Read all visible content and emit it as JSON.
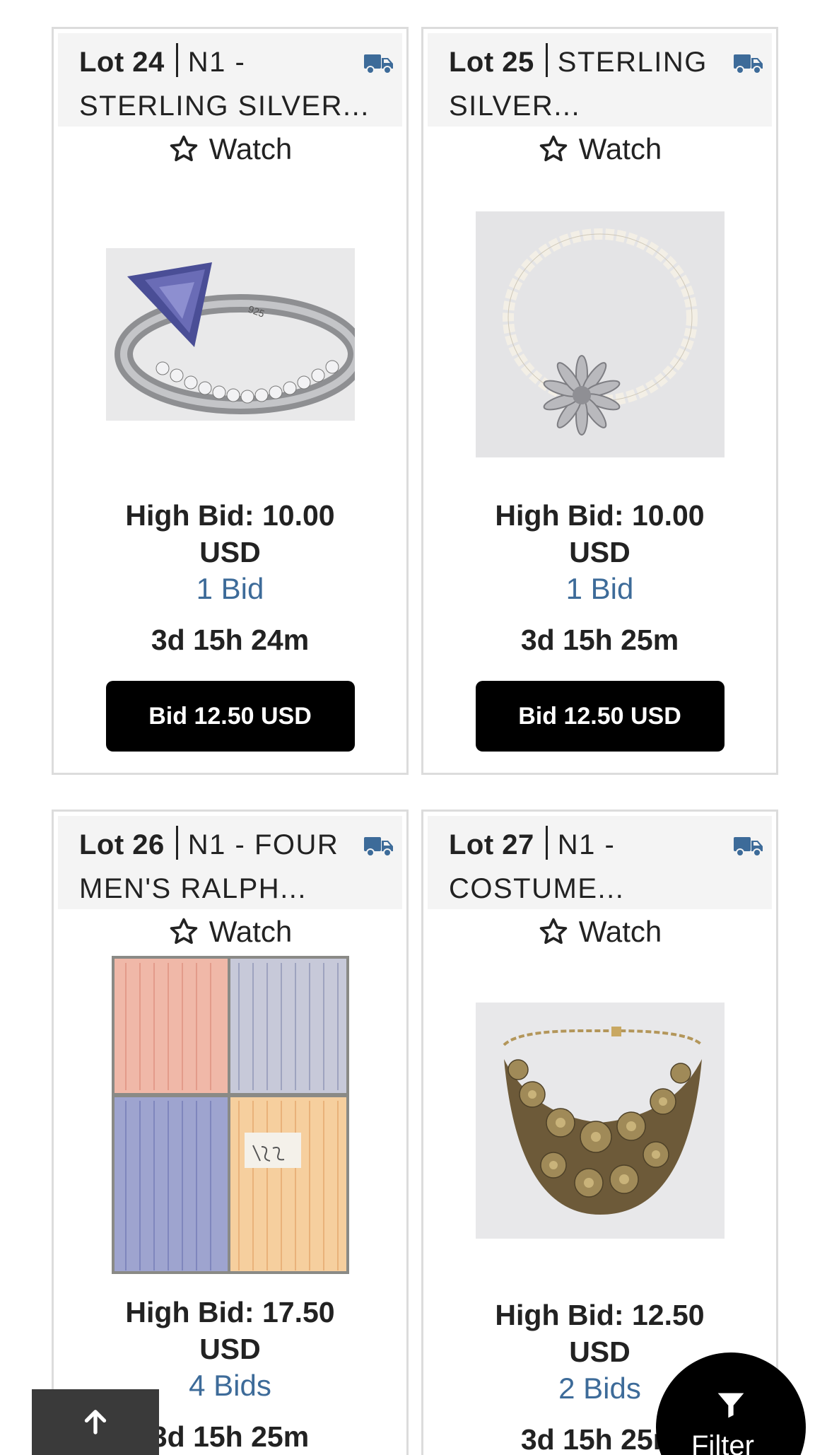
{
  "watch_label": "Watch",
  "lots": [
    {
      "lot": "Lot 24",
      "title_line1": "N1 -",
      "title_line2": "STERLING SILVER...",
      "high_bid": "High Bid: 10.00",
      "currency": "USD",
      "bids": "1 Bid",
      "time_left": "3d 15h 24m",
      "bid_button": "Bid 12.50 USD",
      "image": "sterling-silver-ring-image"
    },
    {
      "lot": "Lot 25",
      "title_line1": "STERLING",
      "title_line2": "SILVER...",
      "high_bid": "High Bid: 10.00",
      "currency": "USD",
      "bids": "1 Bid",
      "time_left": "3d 15h 25m",
      "bid_button": "Bid 12.50 USD",
      "image": "pearl-necklace-image"
    },
    {
      "lot": "Lot 26",
      "title_line1": "N1 - FOUR",
      "title_line2": "MEN'S RALPH...",
      "high_bid": "High Bid: 17.50",
      "currency": "USD",
      "bids": "4 Bids",
      "time_left": "3d 15h 25m",
      "image": "mens-shirts-image"
    },
    {
      "lot": "Lot 27",
      "title_line1": "N1 -",
      "title_line2": "COSTUME...",
      "high_bid": "High Bid: 12.50",
      "currency": "USD",
      "bids": "2 Bids",
      "time_left": "3d 15h 25m",
      "image": "costume-necklace-image"
    }
  ],
  "filter_label": "Filter",
  "colors": {
    "link": "#3d6b99",
    "truck": "#3d6b99",
    "button": "#000000"
  }
}
